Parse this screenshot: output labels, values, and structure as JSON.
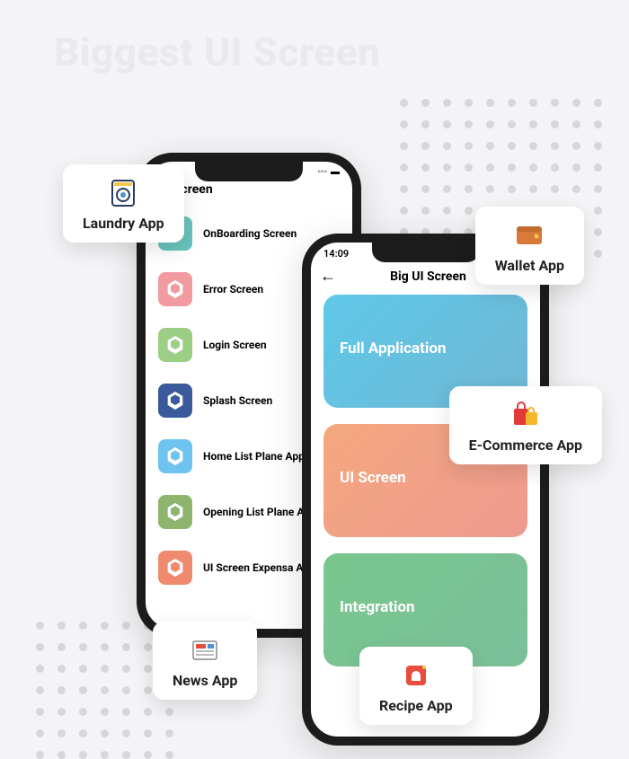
{
  "background": {
    "title": "Biggest UI Screen"
  },
  "phone1": {
    "status_time": "",
    "title": "UI Screen",
    "items": [
      {
        "label": "OnBoarding Screen",
        "color": "#68c4bd"
      },
      {
        "label": "Error Screen",
        "color": "#f19aa0"
      },
      {
        "label": "Login Screen",
        "color": "#9bcf85"
      },
      {
        "label": "Splash Screen",
        "color": "#3a5a9b"
      },
      {
        "label": "Home List Plane App",
        "color": "#6fc3ef"
      },
      {
        "label": "Opening List Plane App",
        "color": "#8db56f"
      },
      {
        "label": "UI Screen Expensa App",
        "color": "#f08a6e"
      }
    ]
  },
  "phone2": {
    "status_time": "14:09",
    "title": "Big UI Screen",
    "cards": [
      {
        "label": "Full Application",
        "gradient": "linear-gradient(135deg,#5fc8e8,#6fb7d4)"
      },
      {
        "label": "UI Screen",
        "gradient": "linear-gradient(135deg,#f5a77e,#ee9a8f)"
      },
      {
        "label": "Integration",
        "gradient": "linear-gradient(135deg,#79c78e,#7bbf99)"
      }
    ]
  },
  "tags": {
    "laundry": "Laundry App",
    "wallet": "Wallet App",
    "ecommerce": "E-Commerce App",
    "news": "News App",
    "recipe": "Recipe App"
  }
}
